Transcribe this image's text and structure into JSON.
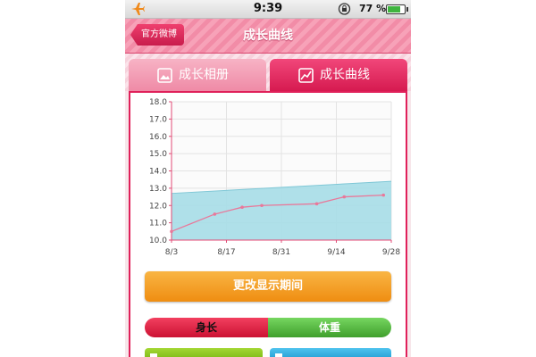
{
  "status_bar": {
    "time": "9:39",
    "battery_percent": "77 %",
    "battery_level": 0.77,
    "icons": [
      "airplane-icon",
      "orientation-lock-icon",
      "battery-icon"
    ]
  },
  "nav": {
    "back_label": "官方微博",
    "title": "成长曲线"
  },
  "tabs": [
    {
      "label": "成长相册",
      "icon": "photo-icon",
      "active": false
    },
    {
      "label": "成长曲线",
      "icon": "chart-icon",
      "active": true
    }
  ],
  "chart_data": {
    "type": "line",
    "title": "",
    "xlabel": "",
    "ylabel": "",
    "ylim": [
      10.0,
      18.0
    ],
    "yticks": [
      "10.0",
      "11.0",
      "12.0",
      "13.0",
      "14.0",
      "15.0",
      "16.0",
      "17.0",
      "18.0"
    ],
    "xticks": [
      "8/3",
      "8/17",
      "8/31",
      "9/14",
      "9/28"
    ],
    "band": {
      "x": [
        "8/3",
        "9/28"
      ],
      "upper": [
        12.7,
        13.4
      ],
      "lower": [
        10.0,
        10.0
      ]
    },
    "series": [
      {
        "x": [
          "8/3",
          "8/14",
          "8/21",
          "8/26",
          "9/9",
          "9/16",
          "9/26"
        ],
        "values": [
          10.5,
          11.5,
          11.9,
          12.0,
          12.1,
          12.5,
          12.6
        ]
      }
    ],
    "grid": true,
    "colors": {
      "band": "#a6dde7",
      "line": "#e9789a",
      "axis": "#e04a74"
    }
  },
  "buttons": {
    "change_period": "更改显示期间",
    "toggle_height": "身长",
    "toggle_weight": "体重"
  },
  "colors": {
    "accent": "#e0205a",
    "orange": "#f2a126",
    "green": "#5fbf45",
    "blue": "#2aa7dc"
  }
}
